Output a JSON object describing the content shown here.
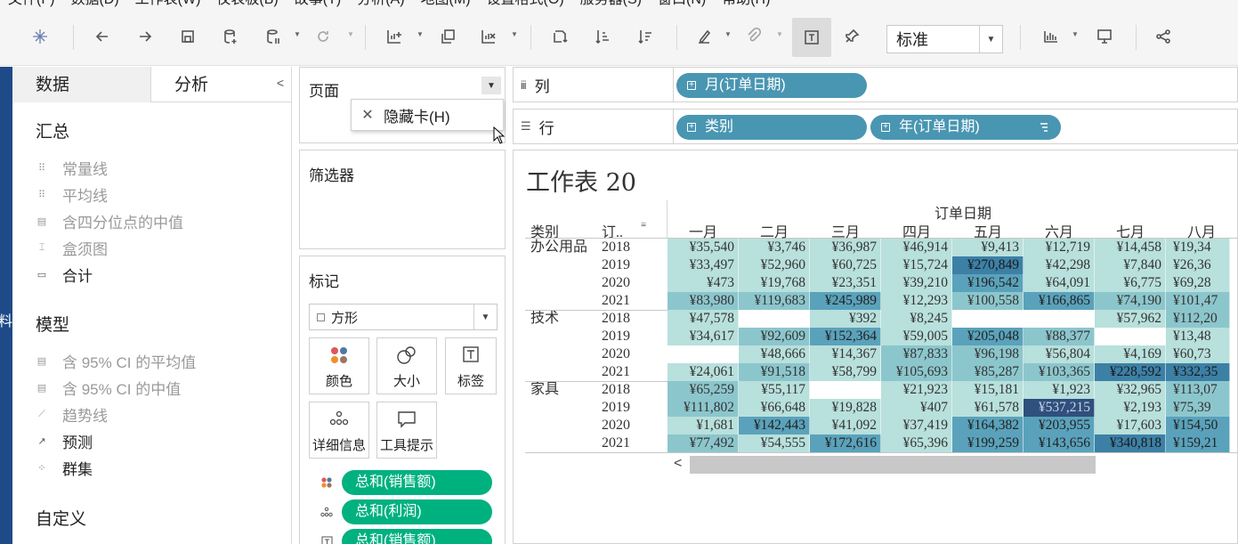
{
  "menu": [
    "文件(F)",
    "数据(D)",
    "工作表(W)",
    "仪表板(B)",
    "故事(T)",
    "分析(A)",
    "地图(M)",
    "设置格式(O)",
    "服务器(S)",
    "窗口(N)",
    "帮助(H)"
  ],
  "toolbar": {
    "fit_value": "标准",
    "icons": [
      "tableau-logo-icon",
      "back-icon",
      "forward-icon",
      "save-icon",
      "new-datasource-icon",
      "pause-updates-icon",
      "refresh-icon",
      "new-worksheet-icon",
      "duplicate-icon",
      "clear-sheet-icon",
      "swap-icon",
      "sort-ascending-icon",
      "sort-descending-icon",
      "highlight-icon",
      "group-icon",
      "show-labels-icon",
      "fix-axes-icon",
      "show-me-icon",
      "presentation-icon",
      "share-icon"
    ]
  },
  "left_panel": {
    "tab_data": "数据",
    "tab_analysis": "分析",
    "edge_text": "料",
    "summary": {
      "title": "汇总",
      "items": [
        {
          "label": "常量线",
          "enabled": false
        },
        {
          "label": "平均线",
          "enabled": false
        },
        {
          "label": "含四分位点的中值",
          "enabled": false
        },
        {
          "label": "盒须图",
          "enabled": false
        },
        {
          "label": "合计",
          "enabled": true
        }
      ]
    },
    "model": {
      "title": "模型",
      "items": [
        {
          "label": "含 95% CI 的平均值",
          "enabled": false
        },
        {
          "label": "含 95% CI 的中值",
          "enabled": false
        },
        {
          "label": "趋势线",
          "enabled": false
        },
        {
          "label": "预测",
          "enabled": true
        },
        {
          "label": "群集",
          "enabled": true
        }
      ]
    },
    "custom": {
      "title": "自定义"
    }
  },
  "pages": {
    "title": "页面",
    "menu_item": "隐藏卡(H)"
  },
  "filters": {
    "title": "筛选器"
  },
  "marks": {
    "title": "标记",
    "type": "方形",
    "buttons": [
      "颜色",
      "大小",
      "标签",
      "详细信息",
      "工具提示"
    ],
    "pills": [
      {
        "icon": "color-dots-icon",
        "label": "总和(销售额)"
      },
      {
        "icon": "detail-dots-icon",
        "label": "总和(利润)"
      },
      {
        "icon": "label-text-icon",
        "label": "总和(销售额)"
      }
    ]
  },
  "shelves": {
    "columns_label": "列",
    "rows_label": "行",
    "columns_pills": [
      "月(订单日期)"
    ],
    "rows_pills": [
      "类别",
      "年(订单日期)"
    ]
  },
  "view": {
    "title": "工作表 20",
    "field_header": "订单日期",
    "row_header_category": "类别",
    "row_header_year": "订..",
    "months": [
      "一月",
      "二月",
      "三月",
      "四月",
      "五月",
      "六月",
      "七月",
      "八月"
    ],
    "colors": {
      "light": "#b8e0dc",
      "mid": "#8cc6cd",
      "deep": "#5aa2bb",
      "darker": "#3c80a6",
      "darkest": "#2f4f7c"
    },
    "rows": [
      {
        "category": "办公用品",
        "year": "2018",
        "cells": [
          {
            "text": "¥35,540",
            "level": 1
          },
          {
            "text": "¥3,746",
            "level": 1
          },
          {
            "text": "¥36,987",
            "level": 1
          },
          {
            "text": "¥46,914",
            "level": 1
          },
          {
            "text": "¥9,413",
            "level": 1
          },
          {
            "text": "¥12,719",
            "level": 1
          },
          {
            "text": "¥14,458",
            "level": 1
          },
          {
            "text": "¥19,34",
            "level": 1
          }
        ]
      },
      {
        "category": "",
        "year": "2019",
        "cells": [
          {
            "text": "¥33,497",
            "level": 1
          },
          {
            "text": "¥52,960",
            "level": 1
          },
          {
            "text": "¥60,725",
            "level": 1
          },
          {
            "text": "¥15,724",
            "level": 1
          },
          {
            "text": "¥270,849",
            "level": 4
          },
          {
            "text": "¥42,298",
            "level": 1
          },
          {
            "text": "¥7,840",
            "level": 1
          },
          {
            "text": "¥26,36",
            "level": 1
          }
        ]
      },
      {
        "category": "",
        "year": "2020",
        "cells": [
          {
            "text": "¥473",
            "level": 1
          },
          {
            "text": "¥19,768",
            "level": 1
          },
          {
            "text": "¥23,351",
            "level": 1
          },
          {
            "text": "¥39,210",
            "level": 1
          },
          {
            "text": "¥196,542",
            "level": 3
          },
          {
            "text": "¥64,091",
            "level": 1
          },
          {
            "text": "¥6,775",
            "level": 1
          },
          {
            "text": "¥69,28",
            "level": 1
          }
        ]
      },
      {
        "category": "",
        "year": "2021",
        "cells": [
          {
            "text": "¥83,980",
            "level": 2
          },
          {
            "text": "¥119,683",
            "level": 2
          },
          {
            "text": "¥245,989",
            "level": 3
          },
          {
            "text": "¥12,293",
            "level": 1
          },
          {
            "text": "¥100,558",
            "level": 2
          },
          {
            "text": "¥166,865",
            "level": 3
          },
          {
            "text": "¥74,190",
            "level": 2
          },
          {
            "text": "¥101,47",
            "level": 2
          }
        ]
      },
      {
        "category": "技术",
        "year": "2018",
        "cells": [
          {
            "text": "¥47,578",
            "level": 1
          },
          {
            "text": "",
            "level": 0
          },
          {
            "text": "¥392",
            "level": 1
          },
          {
            "text": "¥8,245",
            "level": 1
          },
          {
            "text": "",
            "level": 0
          },
          {
            "text": "",
            "level": 0
          },
          {
            "text": "¥57,962",
            "level": 1
          },
          {
            "text": "¥112,20",
            "level": 2
          }
        ]
      },
      {
        "category": "",
        "year": "2019",
        "cells": [
          {
            "text": "¥34,617",
            "level": 1
          },
          {
            "text": "¥92,609",
            "level": 2
          },
          {
            "text": "¥152,364",
            "level": 3
          },
          {
            "text": "¥59,005",
            "level": 1
          },
          {
            "text": "¥205,048",
            "level": 3
          },
          {
            "text": "¥88,377",
            "level": 2
          },
          {
            "text": "",
            "level": 0
          },
          {
            "text": "¥13,48",
            "level": 1
          }
        ]
      },
      {
        "category": "",
        "year": "2020",
        "cells": [
          {
            "text": "",
            "level": 0
          },
          {
            "text": "¥48,666",
            "level": 1
          },
          {
            "text": "¥14,367",
            "level": 1
          },
          {
            "text": "¥87,833",
            "level": 2
          },
          {
            "text": "¥96,198",
            "level": 2
          },
          {
            "text": "¥56,804",
            "level": 1
          },
          {
            "text": "¥4,169",
            "level": 1
          },
          {
            "text": "¥60,73",
            "level": 1
          }
        ]
      },
      {
        "category": "",
        "year": "2021",
        "cells": [
          {
            "text": "¥24,061",
            "level": 1
          },
          {
            "text": "¥91,518",
            "level": 2
          },
          {
            "text": "¥58,799",
            "level": 1
          },
          {
            "text": "¥105,693",
            "level": 2
          },
          {
            "text": "¥85,287",
            "level": 2
          },
          {
            "text": "¥103,365",
            "level": 2
          },
          {
            "text": "¥228,592",
            "level": 4
          },
          {
            "text": "¥332,35",
            "level": 4
          }
        ]
      },
      {
        "category": "家具",
        "year": "2018",
        "cells": [
          {
            "text": "¥65,259",
            "level": 2
          },
          {
            "text": "¥55,117",
            "level": 1
          },
          {
            "text": "",
            "level": 0
          },
          {
            "text": "¥21,923",
            "level": 1
          },
          {
            "text": "¥15,181",
            "level": 1
          },
          {
            "text": "¥1,923",
            "level": 1
          },
          {
            "text": "¥32,965",
            "level": 1
          },
          {
            "text": "¥113,07",
            "level": 2
          }
        ]
      },
      {
        "category": "",
        "year": "2019",
        "cells": [
          {
            "text": "¥111,802",
            "level": 2
          },
          {
            "text": "¥66,648",
            "level": 1
          },
          {
            "text": "¥19,828",
            "level": 1
          },
          {
            "text": "¥407",
            "level": 1
          },
          {
            "text": "¥61,578",
            "level": 1
          },
          {
            "text": "¥537,215",
            "level": 5
          },
          {
            "text": "¥2,193",
            "level": 1
          },
          {
            "text": "¥75,39",
            "level": 2
          }
        ]
      },
      {
        "category": "",
        "year": "2020",
        "cells": [
          {
            "text": "¥1,681",
            "level": 1
          },
          {
            "text": "¥142,443",
            "level": 3
          },
          {
            "text": "¥41,092",
            "level": 1
          },
          {
            "text": "¥37,419",
            "level": 1
          },
          {
            "text": "¥164,382",
            "level": 3
          },
          {
            "text": "¥203,955",
            "level": 3
          },
          {
            "text": "¥17,603",
            "level": 1
          },
          {
            "text": "¥154,50",
            "level": 3
          }
        ]
      },
      {
        "category": "",
        "year": "2021",
        "cells": [
          {
            "text": "¥77,492",
            "level": 2
          },
          {
            "text": "¥54,555",
            "level": 1
          },
          {
            "text": "¥172,616",
            "level": 3
          },
          {
            "text": "¥65,396",
            "level": 1
          },
          {
            "text": "¥199,259",
            "level": 3
          },
          {
            "text": "¥143,656",
            "level": 3
          },
          {
            "text": "¥340,818",
            "level": 4
          },
          {
            "text": "¥159,21",
            "level": 3
          }
        ]
      }
    ]
  }
}
